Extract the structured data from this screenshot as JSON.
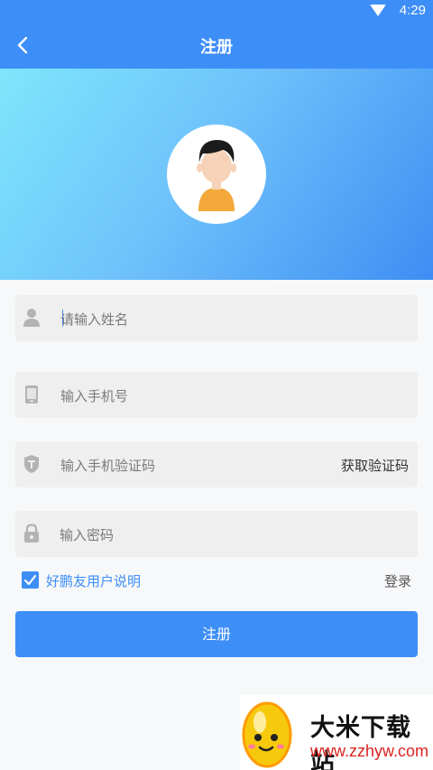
{
  "status_bar": {
    "time": "4:29",
    "wifi_icon": "wifi-icon"
  },
  "header": {
    "title": "注册",
    "back_icon": "back-arrow-icon"
  },
  "colors": {
    "primary": "#3d8ef7",
    "field_bg": "#efefef",
    "page_bg": "#f7f8fa"
  },
  "form": {
    "name_placeholder": "请输入姓名",
    "phone_placeholder": "输入手机号",
    "code_placeholder": "输入手机验证码",
    "get_code_label": "获取验证码",
    "password_placeholder": "输入密码",
    "agreement_label": "好鹏友用户说明",
    "agreement_checked": true,
    "login_link": "登录",
    "submit_label": "注册"
  },
  "watermark": {
    "name": "大米下载站",
    "url": "www.zzhyw.com"
  }
}
